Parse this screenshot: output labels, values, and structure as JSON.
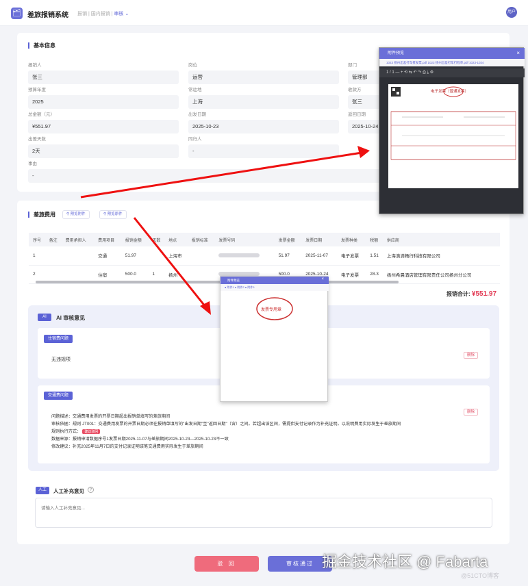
{
  "header": {
    "logo_icon": "🗂",
    "title": "差旅报销系统",
    "crumb1": "报销",
    "crumb2": "国内报销",
    "crumb3": "审核",
    "chevron": "⌄",
    "avatar": "用户"
  },
  "basic": {
    "title": "基本信息",
    "fields": [
      {
        "label": "报销人",
        "value": "张三"
      },
      {
        "label": "岗位",
        "value": "运营"
      },
      {
        "label": "部门",
        "value": "管理部"
      },
      {
        "label": "预算年度",
        "value": "2025"
      },
      {
        "label": "常驻地",
        "value": "上海"
      },
      {
        "label": "收款方",
        "value": "张三"
      },
      {
        "label": "总金额（元）",
        "value": "¥551.97"
      },
      {
        "label": "出发日期",
        "value": "2025-10-23"
      },
      {
        "label": "返回日期",
        "value": "2025-10-24"
      },
      {
        "label": "出差天数",
        "value": "2天"
      },
      {
        "label": "同行人",
        "value": "-"
      },
      {
        "label": "事由",
        "value": "-"
      }
    ]
  },
  "expense": {
    "title": "差旅费用",
    "btn_attach": "预览附件",
    "btn_orig": "预览原件",
    "headers": [
      "序号",
      "备注",
      "费用承担人",
      "费用项目",
      "报销金额",
      "天数",
      "地点",
      "报销标准",
      "发票号码",
      "发票金额",
      "发票日期",
      "发票种类",
      "税额",
      "供应商"
    ],
    "rows": [
      [
        "1",
        "",
        "",
        "交通",
        "51.97",
        "",
        "上海市",
        "",
        "",
        "51.97",
        "2025-11-07",
        "电子发票",
        "1.51",
        "上海滴滴畅行科技有限公司"
      ],
      [
        "2",
        "",
        "",
        "住宿",
        "500.0",
        "1",
        "扬州",
        "",
        "",
        "500.0",
        "2025-10-24",
        "电子发票",
        "28.3",
        "扬州希晨酒店管理有限责任公司扬州分公司"
      ]
    ],
    "total_label": "报销合计:",
    "total_value": "¥551.97"
  },
  "ai": {
    "badge": "AI",
    "title": "AI 审核意见",
    "lodging_tag": "住宿费问题",
    "lodging_text": "无违规项",
    "delete": "删除",
    "transport_tag": "交通费问题",
    "lines": [
      "问题描述：交通费用发票的开票日期超出报销单填写的差旅期间",
      "审核依据：规则 JT001：交通费用发票的开票日期必须在报销单填写的\"出发日期\"至\"返回日期\"（含）之间。若超出该区间，需提供支付记录作为补充证明，以说明费用实际发生于差旅期间",
      "规则执行方式：",
      "数据来源：报销申请数据序号1发票日期2025-11-07与差旅期间2025-10-23—2025-10-23不一致",
      "修改建议：补充2025年11月7日的支付记录证明该笔交通费用实际发生于差旅期间"
    ],
    "rule_tag": "建议驳回"
  },
  "human": {
    "badge": "人工",
    "title": "人工补充意见",
    "help": "?",
    "placeholder": "请输入人工补充意见..."
  },
  "actions": {
    "reject": "驳 回",
    "pass": "审核通过"
  },
  "watermark": {
    "text": "掘金技术社区 @ Fabarta",
    "sub": "@51CTO博客"
  },
  "preview": {
    "title": "附件预览",
    "tabs": "1023 扬州出差打车费发票.pdf   1023 扬州出差打车行程单.pdf   1023-1024",
    "toolbar": "1 / 1   —  +   ⟲   ⇆   ↶  ↷      ⎙  ⤓  ⚙",
    "doc_title": "电子发票（普通发票）",
    "close": "×",
    "small_title": "附件预览",
    "small_tabs": "● 附件1   ● 附件2   ● 附件3",
    "stamp": "发票专用章"
  }
}
